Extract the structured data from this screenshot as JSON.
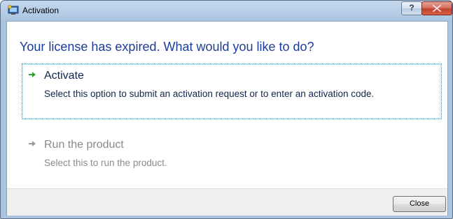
{
  "window": {
    "title": "Activation",
    "help_label": "?"
  },
  "dialog": {
    "heading": "Your license has expired. What would you like to do?",
    "options": [
      {
        "title": "Activate",
        "description": "Select this option to submit an activation request or to enter an activation code.",
        "icon": "green-arrow-icon",
        "enabled": true
      },
      {
        "title": "Run the product",
        "description": "Select this to run the product.",
        "icon": "gray-arrow-icon",
        "enabled": false
      }
    ]
  },
  "footer": {
    "close_label": "Close"
  },
  "colors": {
    "heading": "#1c3c9c",
    "active_arrow": "#2aa12a",
    "disabled_text": "#8a8a8a"
  }
}
